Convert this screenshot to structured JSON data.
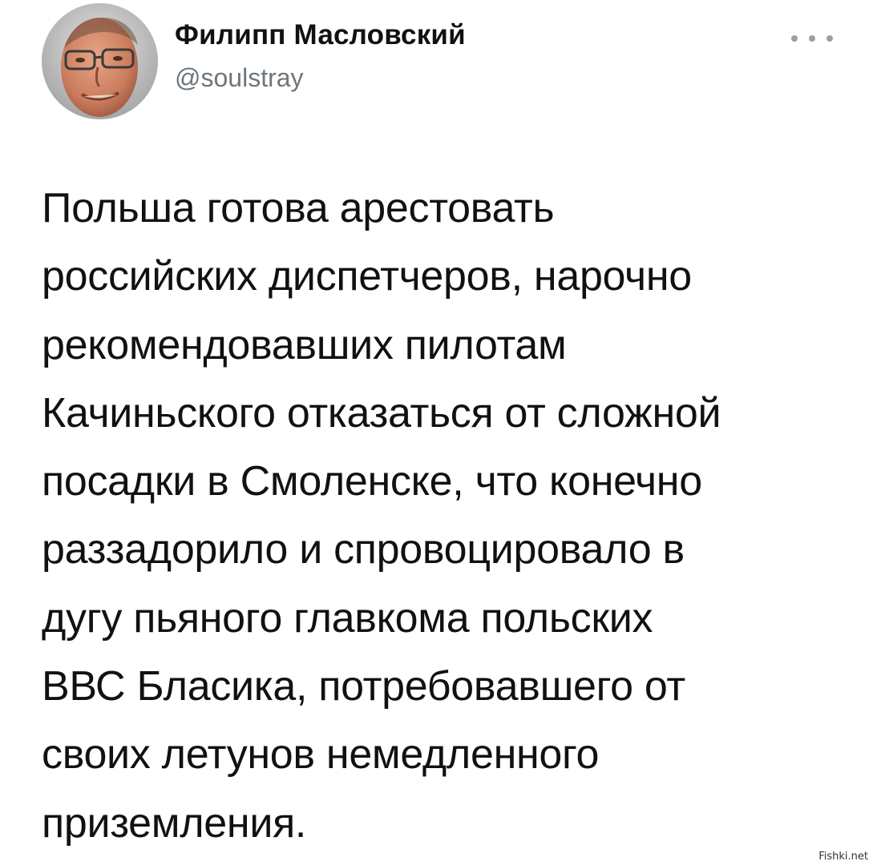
{
  "tweet": {
    "author": {
      "name": "Филипп Масловский",
      "handle": "@soulstray"
    },
    "more_icon": "more-horizontal-icon",
    "text_lines": [
      "Польша готова арестовать",
      "российских диспетчеров, нарочно",
      "рекомендовавших пилотам",
      "Качиньского отказаться от сложной",
      "посадки в Смоленске, что конечно",
      "раззадорило и спровоцировало в",
      "дугу пьяного главкома польских",
      "ВВС Бласика, потребовавшего от",
      "своих летунов немедленного",
      "приземления."
    ]
  },
  "watermark": "Fishki.net",
  "colors": {
    "text": "#111111",
    "handle": "#6e767d",
    "background": "#ffffff"
  }
}
